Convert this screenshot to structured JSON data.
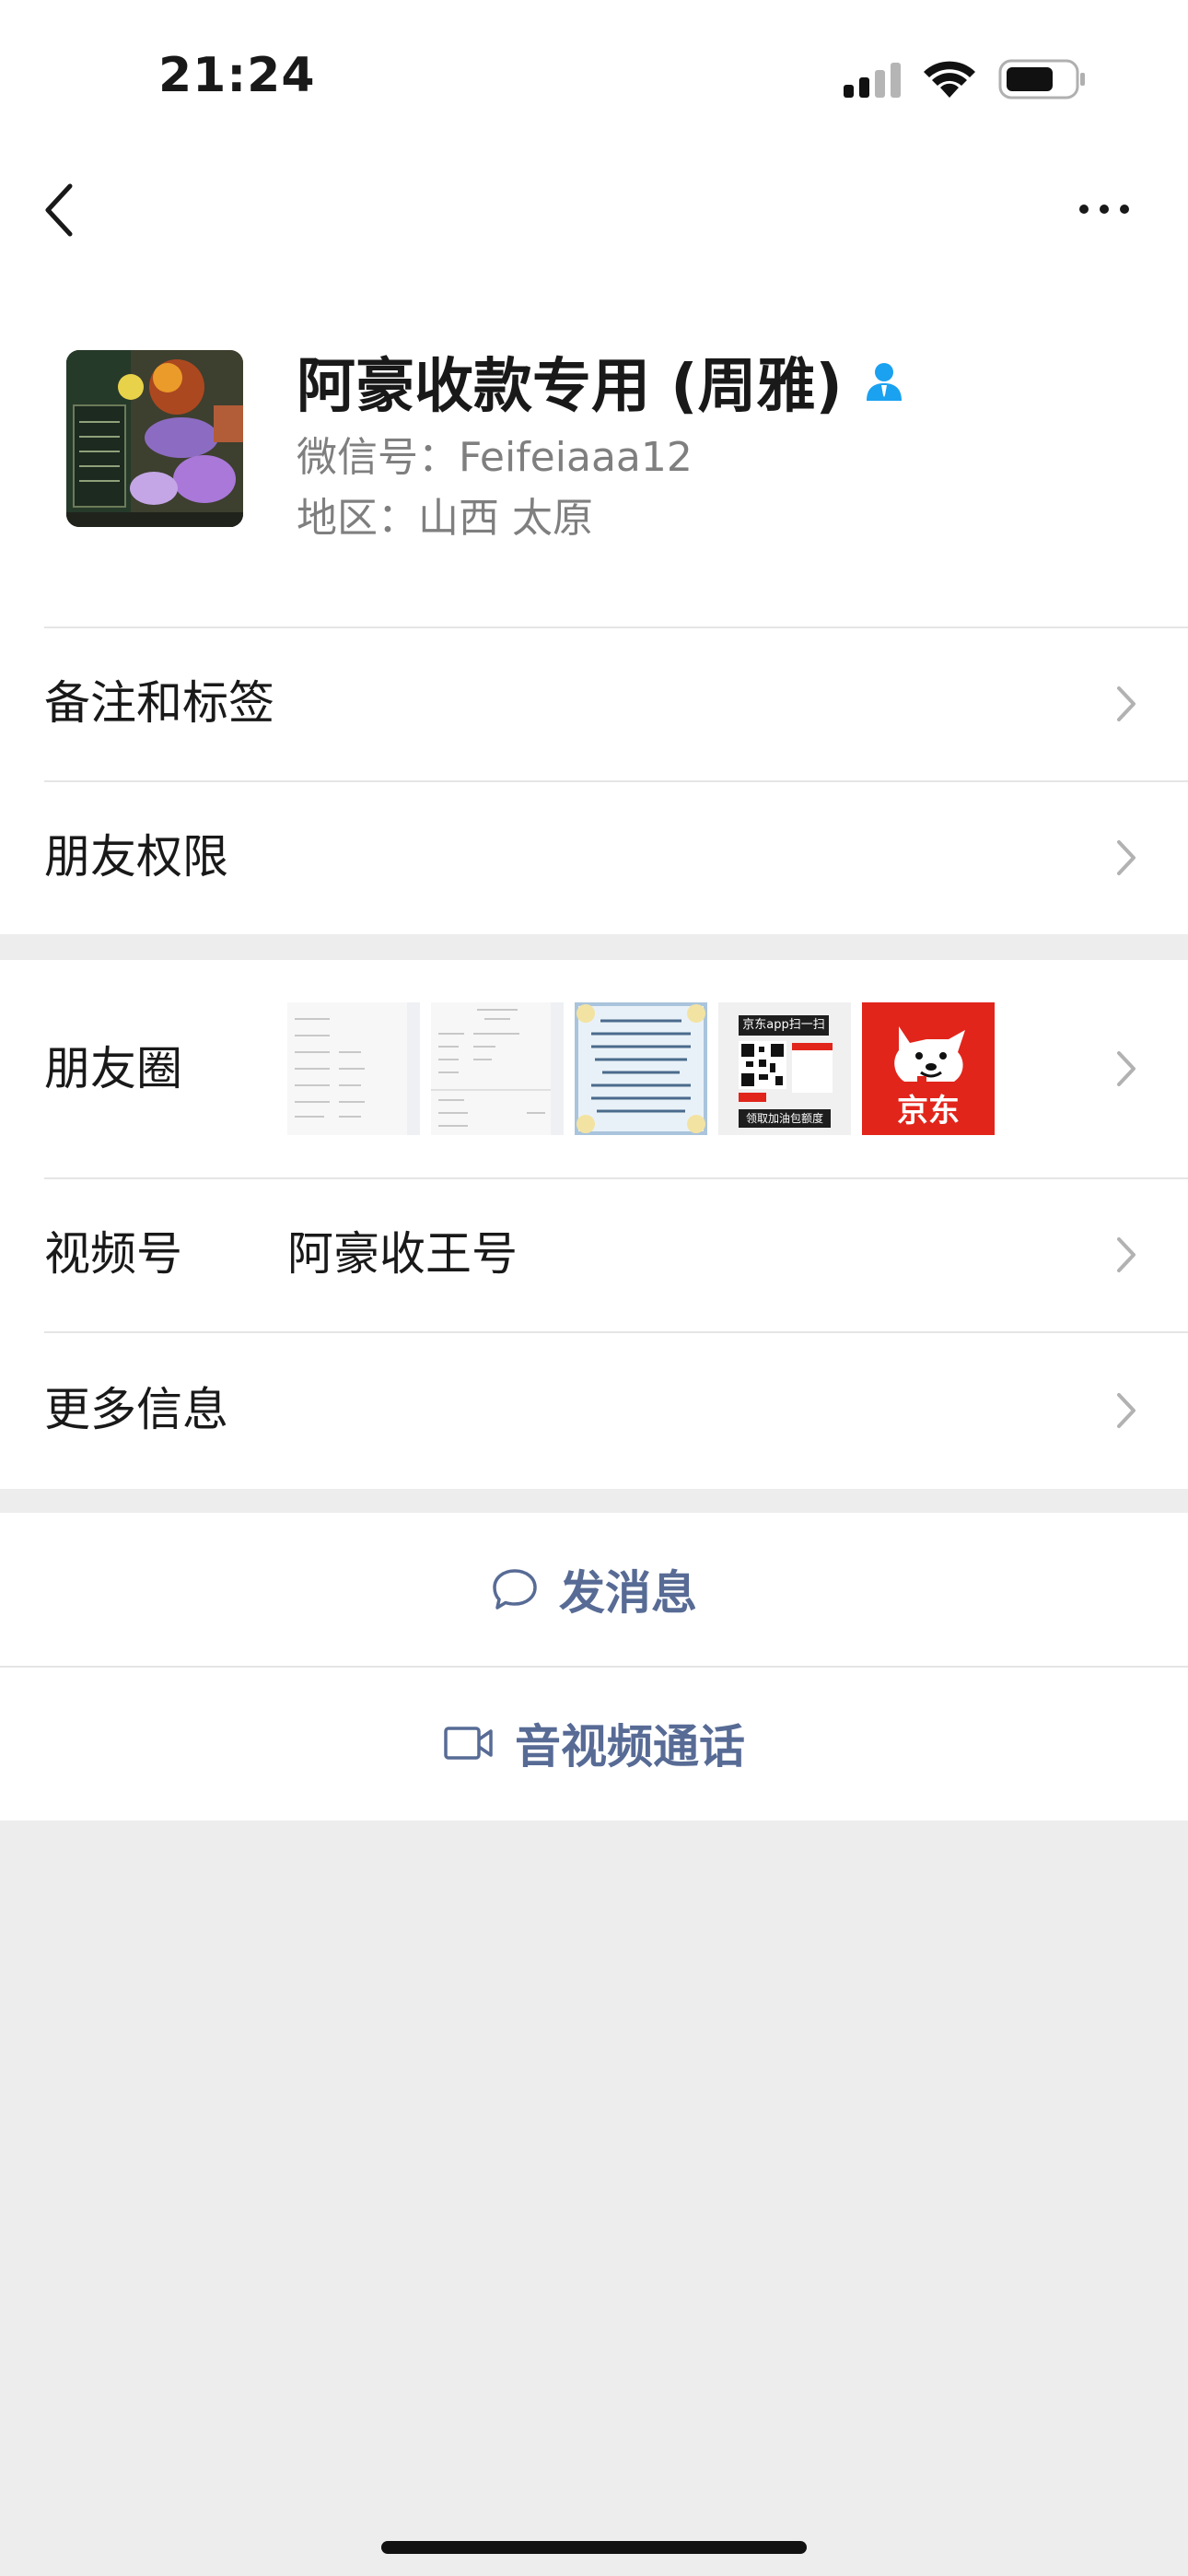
{
  "status_bar": {
    "time": "21:24"
  },
  "nav": {
    "back_icon": "chevron-left-icon",
    "more_icon": "ellipsis-icon"
  },
  "profile": {
    "name": "阿豪收款专用 (周雅)",
    "wechat_id": "微信号：Feifeiaaa12",
    "region": "地区：山西 太原"
  },
  "menu": {
    "remarks_label": "备注和标签",
    "permissions_label": "朋友权限",
    "moments_label": "朋友圈",
    "channels_label": "视频号",
    "channels_value": "阿豪收王号",
    "more_info_label": "更多信息"
  },
  "moments_thumbs": {
    "jd_app_scan": "京东app扫一扫",
    "jd_quota_button": "领取加油包额度",
    "jd_logo_text": "京东"
  },
  "actions": {
    "message_label": "发消息",
    "call_label": "音视频通话"
  },
  "colors": {
    "link": "#576b95",
    "verify_blue": "#1aa1f0",
    "jd_red": "#e1251b"
  }
}
